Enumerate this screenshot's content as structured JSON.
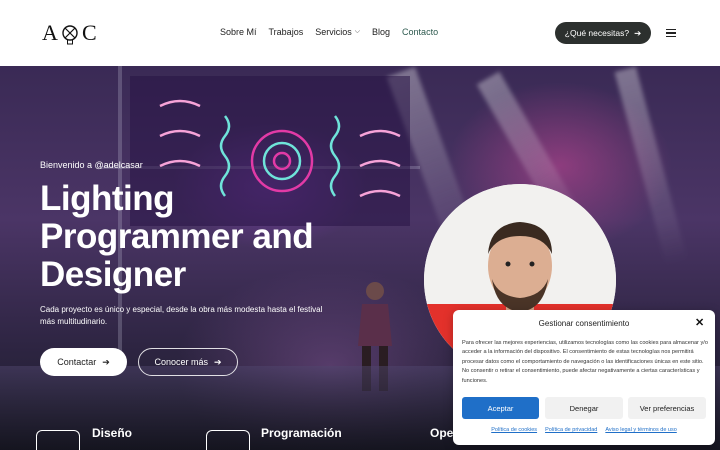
{
  "header": {
    "logo_text": "A C",
    "nav": [
      {
        "label": "Sobre Mí"
      },
      {
        "label": "Trabajos"
      },
      {
        "label": "Servicios"
      },
      {
        "label": "Blog"
      },
      {
        "label": "Contacto"
      }
    ],
    "cta_label": "¿Qué necesitas?",
    "accent_color": "#2e5a4f"
  },
  "hero": {
    "welcome": "Bienvenido a @adelcasar",
    "title": "Lighting Programmer and Designer",
    "description": "Cada proyecto es único y especial, desde la obra más modesta hasta el festival más multitudinario.",
    "primary_button": "Contactar",
    "secondary_button": "Conocer más"
  },
  "services": [
    {
      "label": "Diseño"
    },
    {
      "label": "Programación"
    },
    {
      "label": "Ope"
    }
  ],
  "consent": {
    "title": "Gestionar consentimiento",
    "text": "Para ofrecer las mejores experiencias, utilizamos tecnologías como las cookies para almacenar y/o acceder a la información del dispositivo. El consentimiento de estas tecnologías nos permitirá procesar datos como el comportamiento de navegación o las identificaciones únicas en este sitio. No consentir o retirar el consentimiento, puede afectar negativamente a ciertas características y funciones.",
    "accept": "Aceptar",
    "deny": "Denegar",
    "preferences": "Ver preferencias",
    "links": [
      "Política de cookies",
      "Política de privacidad",
      "Aviso legal y términos de uso"
    ],
    "accept_color": "#1f6fc8"
  }
}
